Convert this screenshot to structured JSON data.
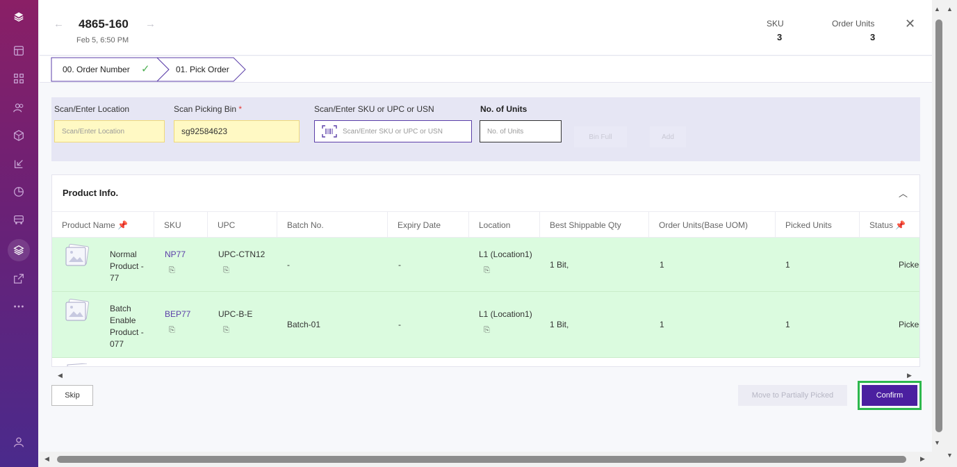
{
  "header": {
    "order_number": "4865-160",
    "order_date": "Feb 5, 6:50 PM",
    "sku_label": "SKU",
    "sku_value": "3",
    "order_units_label": "Order Units",
    "order_units_value": "3"
  },
  "steps": [
    {
      "label": "00. Order Number",
      "done": true
    },
    {
      "label": "01. Pick Order",
      "done": false
    }
  ],
  "scan": {
    "location_label": "Scan/Enter Location",
    "location_placeholder": "Scan/Enter Location",
    "bin_label": "Scan Picking Bin",
    "bin_required": "*",
    "bin_value": "sg92584623",
    "sku_label": "Scan/Enter SKU or UPC or USN",
    "sku_placeholder": "Scan/Enter SKU or UPC or USN",
    "units_label": "No. of Units",
    "units_placeholder": "No. of Units",
    "bin_full_label": "Bin Full",
    "add_label": "Add"
  },
  "product_info": {
    "title": "Product Info.",
    "columns": [
      "Product Name",
      "SKU",
      "UPC",
      "Batch No.",
      "Expiry Date",
      "Location",
      "Best Shippable Qty",
      "Order Units(Base UOM)",
      "Picked Units",
      "Status"
    ],
    "rows": [
      {
        "name_lines": [
          "Normal",
          "Product -",
          "77"
        ],
        "sku": "NP77",
        "upc": "UPC-CTN12",
        "batch": "-",
        "expiry": "-",
        "location": "L1 (Location1)",
        "best_qty": "1 Bit,",
        "order_units": "1",
        "picked_units": "1",
        "status": "Picked"
      },
      {
        "name_lines": [
          "Batch",
          "Enable",
          "Product -",
          "077"
        ],
        "sku": "BEP77",
        "upc": "UPC-B-E",
        "batch": "Batch-01",
        "expiry": "-",
        "location": "L1 (Location1)",
        "best_qty": "1 Bit,",
        "order_units": "1",
        "picked_units": "1",
        "status": "Picked"
      }
    ]
  },
  "footer": {
    "skip_label": "Skip",
    "partial_label": "Move to Partially Picked",
    "confirm_label": "Confirm"
  },
  "colors": {
    "accent": "#4b1fa0",
    "row_picked": "#dbfbdf",
    "confirm_highlight": "#2db84d",
    "input_yellow": "#fff9c4"
  }
}
